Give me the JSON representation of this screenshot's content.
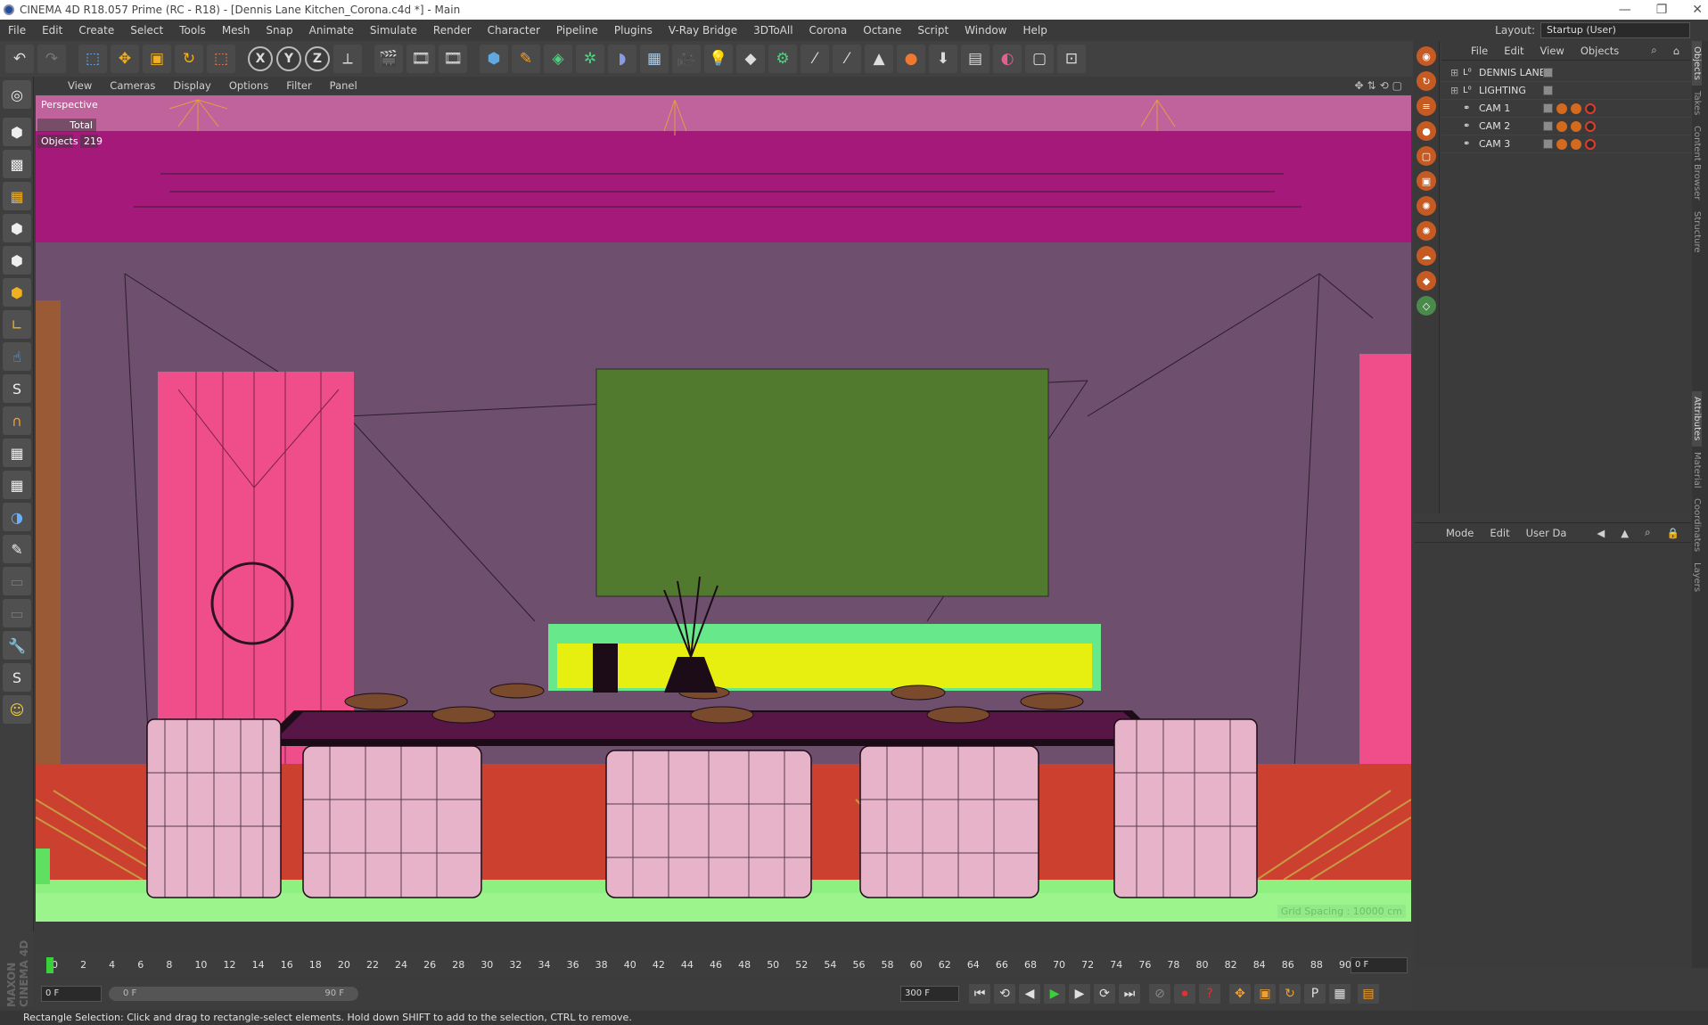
{
  "window": {
    "title": "CINEMA 4D R18.057 Prime (RC - R18) - [Dennis Lane Kitchen_Corona.c4d *] - Main",
    "controls": [
      "—",
      "❐",
      "✕"
    ]
  },
  "menu": [
    "File",
    "Edit",
    "Create",
    "Select",
    "Tools",
    "Mesh",
    "Snap",
    "Animate",
    "Simulate",
    "Render",
    "Character",
    "Pipeline",
    "Plugins",
    "V-Ray Bridge",
    "3DToAll",
    "Corona",
    "Octane",
    "Script",
    "Window",
    "Help"
  ],
  "layout": {
    "label": "Layout:",
    "value": "Startup (User)"
  },
  "viewport": {
    "menu": [
      "View",
      "Cameras",
      "Display",
      "Options",
      "Filter",
      "Panel"
    ],
    "name": "Perspective",
    "stats_header": "Total",
    "stats_label": "Objects",
    "stats_value": "219",
    "grid_spacing": "Grid Spacing : 10000 cm"
  },
  "objects_panel": {
    "menu": [
      "File",
      "Edit",
      "View",
      "Objects"
    ],
    "items": [
      {
        "name": "DENNIS LANE",
        "type": "layer",
        "icon": "null-object-icon",
        "expandable": true
      },
      {
        "name": "LIGHTING",
        "type": "layer",
        "icon": "null-object-icon",
        "expandable": true
      },
      {
        "name": "CAM 1",
        "type": "camera",
        "icon": "camera-icon",
        "expandable": false
      },
      {
        "name": "CAM 2",
        "type": "camera",
        "icon": "camera-icon",
        "expandable": false
      },
      {
        "name": "CAM 3",
        "type": "camera",
        "icon": "camera-icon",
        "expandable": false
      }
    ]
  },
  "attributes_panel": {
    "menu": [
      "Mode",
      "Edit",
      "User Da"
    ]
  },
  "side_tabs": {
    "top": [
      "Objects",
      "Takes",
      "Content Browser",
      "Structure"
    ],
    "bottom": [
      "Attributes",
      "Material",
      "Coordinates",
      "Layers"
    ]
  },
  "timeline": {
    "ticks": [
      "0",
      "2",
      "4",
      "6",
      "8",
      "10",
      "12",
      "14",
      "16",
      "18",
      "20",
      "22",
      "24",
      "26",
      "28",
      "30",
      "32",
      "34",
      "36",
      "38",
      "40",
      "42",
      "44",
      "46",
      "48",
      "50",
      "52",
      "54",
      "56",
      "58",
      "60",
      "62",
      "64",
      "66",
      "68",
      "70",
      "72",
      "74",
      "76",
      "78",
      "80",
      "82",
      "84",
      "86",
      "88",
      "90"
    ],
    "current_frame": "0 F"
  },
  "transport": {
    "start": "0 F",
    "slider_start": "0 F",
    "slider_end": "90 F",
    "end": "300 F"
  },
  "status": "Rectangle Selection: Click and drag to rectangle-select elements. Hold down SHIFT to add to the selection, CTRL to remove.",
  "branding": "MAXON CINEMA 4D",
  "colors": {
    "accent": "#c65a23",
    "ceiling": "#a5197a",
    "wall": "#6e4f6d",
    "curtain": "#f04d8b",
    "artwork": "#527a2f",
    "floor": "#cc4030",
    "floor_strip": "#8ef07e"
  }
}
